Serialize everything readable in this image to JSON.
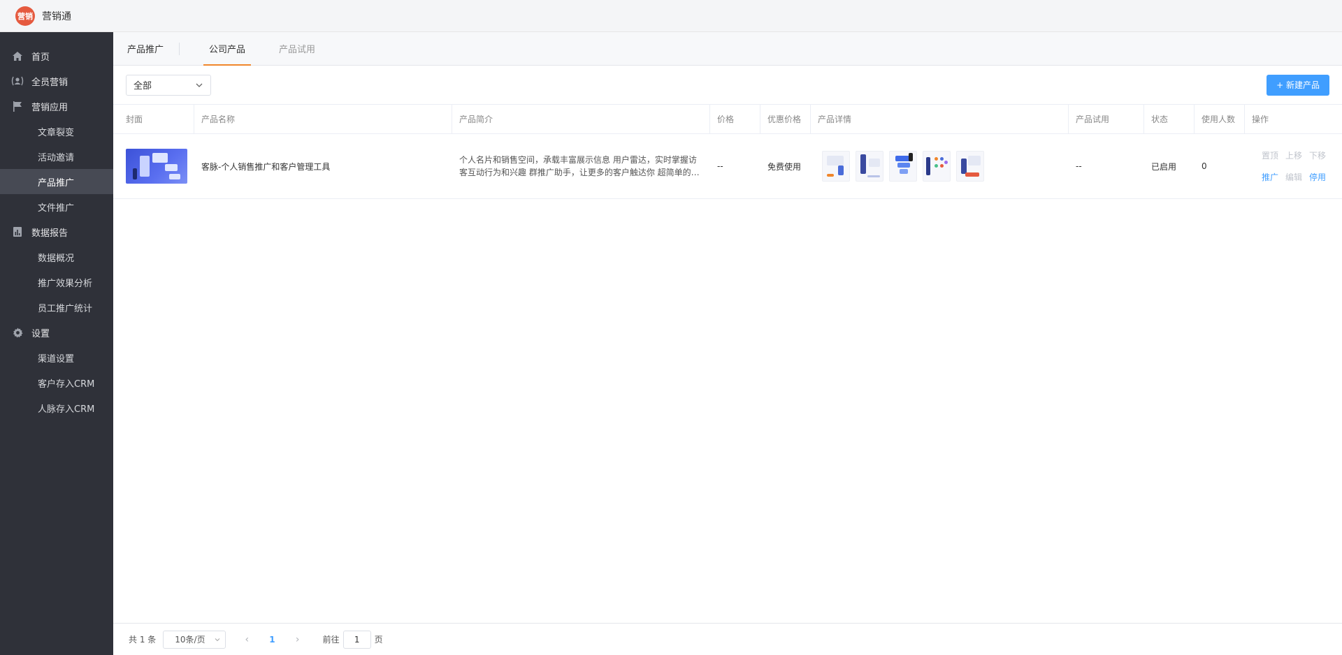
{
  "app": {
    "logo_text": "营销",
    "name": "营销通"
  },
  "sidebar": {
    "home": {
      "label": "首页",
      "icon": "home-icon"
    },
    "all_staff": {
      "label": "全员营销",
      "icon": "users-icon"
    },
    "marketing_apps": {
      "label": "营销应用",
      "icon": "flag-icon",
      "items": [
        "文章裂变",
        "活动邀请",
        "产品推广",
        "文件推广"
      ],
      "active_index": 2
    },
    "data_report": {
      "label": "数据报告",
      "icon": "report-icon",
      "items": [
        "数据概况",
        "推广效果分析",
        "员工推广统计"
      ]
    },
    "settings": {
      "label": "设置",
      "icon": "gear-icon",
      "items": [
        "渠道设置",
        "客户存入CRM",
        "人脉存入CRM"
      ]
    }
  },
  "tabs": [
    "产品推广",
    "公司产品",
    "产品试用"
  ],
  "active_tab": 1,
  "toolbar": {
    "filter_value": "全部",
    "new_button": "+ 新建产品"
  },
  "table": {
    "columns": [
      "封面",
      "产品名称",
      "产品简介",
      "价格",
      "优惠价格",
      "产品详情",
      "产品试用",
      "状态",
      "使用人数",
      "操作"
    ],
    "rows": [
      {
        "name": "客脉-个人销售推广和客户管理工具",
        "intro": "个人名片和销售空间，承载丰富展示信息 用户雷达，实时掌握访客互动行为和兴趣 群推广助手，让更多的客户触达你 超简单的…",
        "price": "--",
        "discount_price": "免费使用",
        "trial": "--",
        "status": "已启用",
        "users": "0",
        "ops_row1": [
          "置顶",
          "上移",
          "下移"
        ],
        "ops_row2": [
          "推广",
          "编辑",
          "停用"
        ]
      }
    ]
  },
  "pagination": {
    "total": "共 1 条",
    "page_size": "10条/页",
    "current_page": "1",
    "goto_label": "前往",
    "goto_value": "1",
    "page_suffix": "页"
  },
  "colors": {
    "accent": "#409eff",
    "tab_underline": "#f0862b",
    "sidebar_bg": "#2f3139",
    "logo": "#e55a3f"
  }
}
